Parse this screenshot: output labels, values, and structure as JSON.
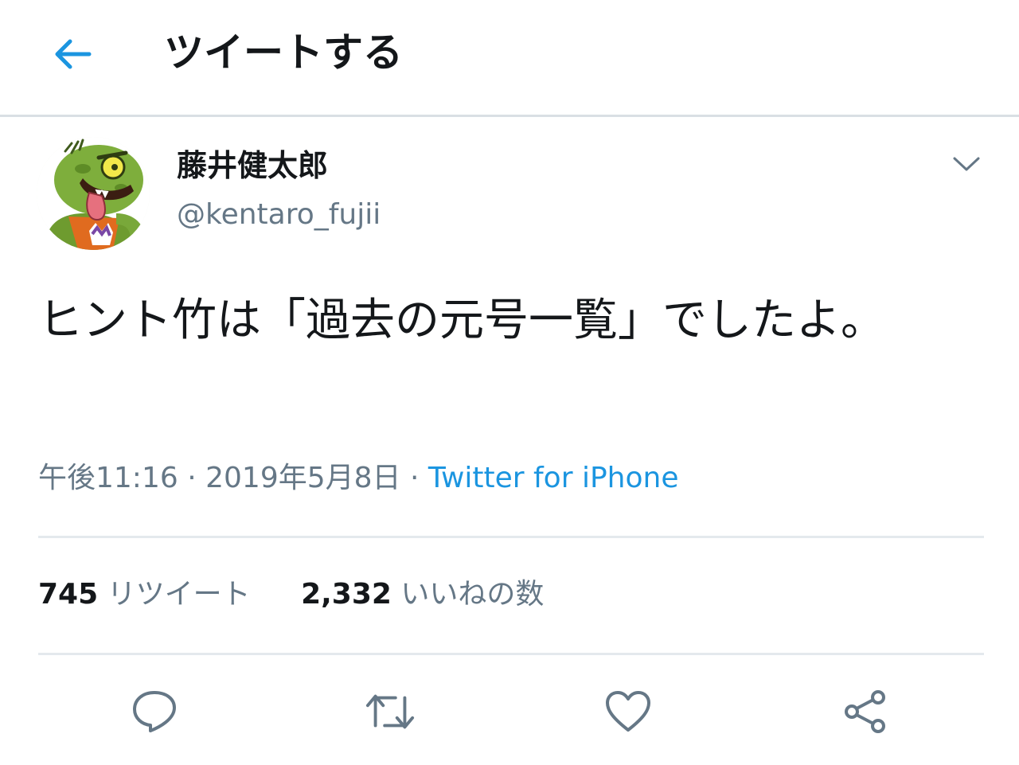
{
  "header": {
    "back_icon": "arrow-left-icon",
    "title": "ツイートする"
  },
  "colors": {
    "accent": "#1b95e0",
    "text": "#14171a",
    "secondary": "#657786",
    "divider": "#e4e9ed"
  },
  "tweet": {
    "author": {
      "display_name": "藤井健太郎",
      "handle": "@kentaro_fujii",
      "avatar_icon": "cartoon-monster-avatar"
    },
    "menu_icon": "chevron-down-icon",
    "text": "ヒント竹は「過去の元号一覧」でしたよ。",
    "time": "午後11:16",
    "date": "2019年5月8日",
    "separator": "·",
    "source": "Twitter for iPhone"
  },
  "stats": {
    "retweets_count": "745",
    "retweets_label": "リツイート",
    "likes_count": "2,332",
    "likes_label": "いいねの数"
  },
  "actions": [
    {
      "icon": "reply-icon"
    },
    {
      "icon": "retweet-icon"
    },
    {
      "icon": "like-heart-icon"
    },
    {
      "icon": "share-icon"
    }
  ]
}
